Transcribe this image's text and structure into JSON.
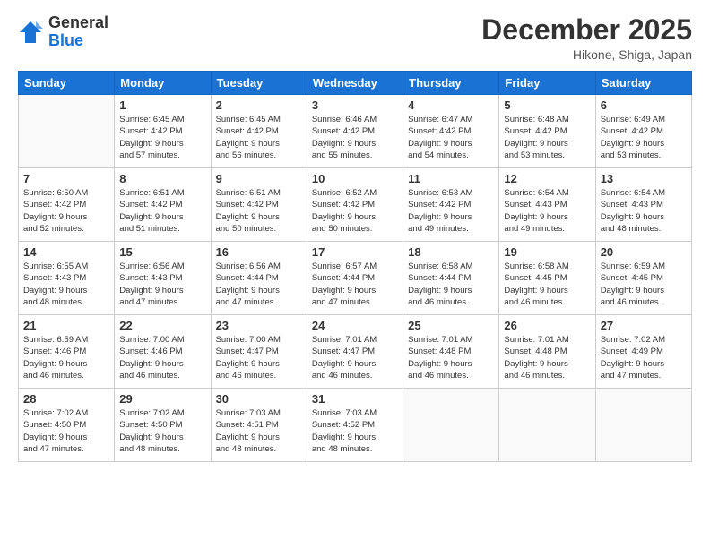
{
  "header": {
    "logo_general": "General",
    "logo_blue": "Blue",
    "month_title": "December 2025",
    "location": "Hikone, Shiga, Japan"
  },
  "weekdays": [
    "Sunday",
    "Monday",
    "Tuesday",
    "Wednesday",
    "Thursday",
    "Friday",
    "Saturday"
  ],
  "weeks": [
    [
      {
        "day": "",
        "info": ""
      },
      {
        "day": "1",
        "info": "Sunrise: 6:45 AM\nSunset: 4:42 PM\nDaylight: 9 hours\nand 57 minutes."
      },
      {
        "day": "2",
        "info": "Sunrise: 6:45 AM\nSunset: 4:42 PM\nDaylight: 9 hours\nand 56 minutes."
      },
      {
        "day": "3",
        "info": "Sunrise: 6:46 AM\nSunset: 4:42 PM\nDaylight: 9 hours\nand 55 minutes."
      },
      {
        "day": "4",
        "info": "Sunrise: 6:47 AM\nSunset: 4:42 PM\nDaylight: 9 hours\nand 54 minutes."
      },
      {
        "day": "5",
        "info": "Sunrise: 6:48 AM\nSunset: 4:42 PM\nDaylight: 9 hours\nand 53 minutes."
      },
      {
        "day": "6",
        "info": "Sunrise: 6:49 AM\nSunset: 4:42 PM\nDaylight: 9 hours\nand 53 minutes."
      }
    ],
    [
      {
        "day": "7",
        "info": "Sunrise: 6:50 AM\nSunset: 4:42 PM\nDaylight: 9 hours\nand 52 minutes."
      },
      {
        "day": "8",
        "info": "Sunrise: 6:51 AM\nSunset: 4:42 PM\nDaylight: 9 hours\nand 51 minutes."
      },
      {
        "day": "9",
        "info": "Sunrise: 6:51 AM\nSunset: 4:42 PM\nDaylight: 9 hours\nand 50 minutes."
      },
      {
        "day": "10",
        "info": "Sunrise: 6:52 AM\nSunset: 4:42 PM\nDaylight: 9 hours\nand 50 minutes."
      },
      {
        "day": "11",
        "info": "Sunrise: 6:53 AM\nSunset: 4:42 PM\nDaylight: 9 hours\nand 49 minutes."
      },
      {
        "day": "12",
        "info": "Sunrise: 6:54 AM\nSunset: 4:43 PM\nDaylight: 9 hours\nand 49 minutes."
      },
      {
        "day": "13",
        "info": "Sunrise: 6:54 AM\nSunset: 4:43 PM\nDaylight: 9 hours\nand 48 minutes."
      }
    ],
    [
      {
        "day": "14",
        "info": "Sunrise: 6:55 AM\nSunset: 4:43 PM\nDaylight: 9 hours\nand 48 minutes."
      },
      {
        "day": "15",
        "info": "Sunrise: 6:56 AM\nSunset: 4:43 PM\nDaylight: 9 hours\nand 47 minutes."
      },
      {
        "day": "16",
        "info": "Sunrise: 6:56 AM\nSunset: 4:44 PM\nDaylight: 9 hours\nand 47 minutes."
      },
      {
        "day": "17",
        "info": "Sunrise: 6:57 AM\nSunset: 4:44 PM\nDaylight: 9 hours\nand 47 minutes."
      },
      {
        "day": "18",
        "info": "Sunrise: 6:58 AM\nSunset: 4:44 PM\nDaylight: 9 hours\nand 46 minutes."
      },
      {
        "day": "19",
        "info": "Sunrise: 6:58 AM\nSunset: 4:45 PM\nDaylight: 9 hours\nand 46 minutes."
      },
      {
        "day": "20",
        "info": "Sunrise: 6:59 AM\nSunset: 4:45 PM\nDaylight: 9 hours\nand 46 minutes."
      }
    ],
    [
      {
        "day": "21",
        "info": "Sunrise: 6:59 AM\nSunset: 4:46 PM\nDaylight: 9 hours\nand 46 minutes."
      },
      {
        "day": "22",
        "info": "Sunrise: 7:00 AM\nSunset: 4:46 PM\nDaylight: 9 hours\nand 46 minutes."
      },
      {
        "day": "23",
        "info": "Sunrise: 7:00 AM\nSunset: 4:47 PM\nDaylight: 9 hours\nand 46 minutes."
      },
      {
        "day": "24",
        "info": "Sunrise: 7:01 AM\nSunset: 4:47 PM\nDaylight: 9 hours\nand 46 minutes."
      },
      {
        "day": "25",
        "info": "Sunrise: 7:01 AM\nSunset: 4:48 PM\nDaylight: 9 hours\nand 46 minutes."
      },
      {
        "day": "26",
        "info": "Sunrise: 7:01 AM\nSunset: 4:48 PM\nDaylight: 9 hours\nand 46 minutes."
      },
      {
        "day": "27",
        "info": "Sunrise: 7:02 AM\nSunset: 4:49 PM\nDaylight: 9 hours\nand 47 minutes."
      }
    ],
    [
      {
        "day": "28",
        "info": "Sunrise: 7:02 AM\nSunset: 4:50 PM\nDaylight: 9 hours\nand 47 minutes."
      },
      {
        "day": "29",
        "info": "Sunrise: 7:02 AM\nSunset: 4:50 PM\nDaylight: 9 hours\nand 48 minutes."
      },
      {
        "day": "30",
        "info": "Sunrise: 7:03 AM\nSunset: 4:51 PM\nDaylight: 9 hours\nand 48 minutes."
      },
      {
        "day": "31",
        "info": "Sunrise: 7:03 AM\nSunset: 4:52 PM\nDaylight: 9 hours\nand 48 minutes."
      },
      {
        "day": "",
        "info": ""
      },
      {
        "day": "",
        "info": ""
      },
      {
        "day": "",
        "info": ""
      }
    ]
  ]
}
